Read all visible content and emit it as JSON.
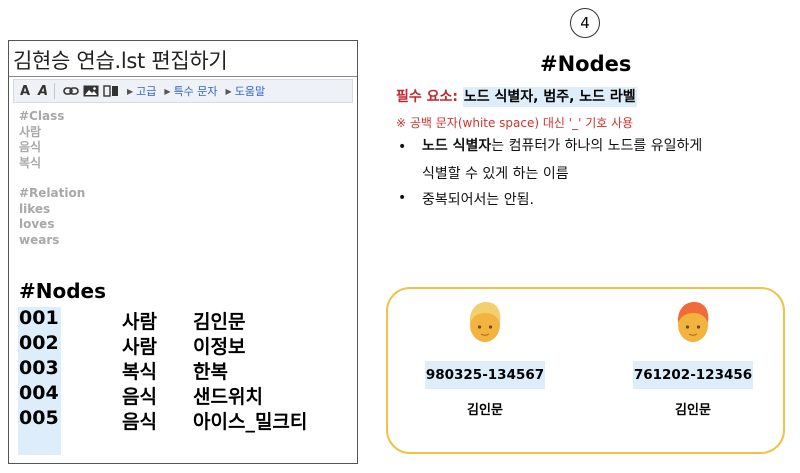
{
  "editor": {
    "title": "김현승 연습.lst 편집하기",
    "toolbar": {
      "bold_label": "A",
      "italic_label": "A",
      "menus": [
        "고급",
        "특수 문자",
        "도움말"
      ]
    },
    "class_section": [
      "#Class",
      "사람",
      "음식",
      "복식"
    ],
    "relation_section": [
      "#Relation",
      "likes",
      "loves",
      "wears"
    ],
    "nodes_heading": "#Nodes",
    "nodes": [
      {
        "id": "001",
        "category": "사람",
        "label": "김인문"
      },
      {
        "id": "002",
        "category": "사람",
        "label": "이정보"
      },
      {
        "id": "003",
        "category": "복식",
        "label": "한복"
      },
      {
        "id": "004",
        "category": "음식",
        "label": "샌드위치"
      },
      {
        "id": "005",
        "category": "음식",
        "label": "아이스_밀크티"
      }
    ]
  },
  "panel": {
    "step_number": "4",
    "title": "#Nodes",
    "required_label": "필수 요소:",
    "required_items": "노드 식별자, 범주, 노드 라벨",
    "note": "※ 공백 문자(white space) 대신 '_' 기호 사용",
    "bullet1_bold": "노드 식별자",
    "bullet1_rest": "는 컴퓨터가 하나의 노드를 유일하게",
    "bullet1_line2": "식별할 수 있게 하는 이름",
    "bullet2": "중복되어서는 안됨.",
    "people": [
      {
        "id": "980325-134567",
        "name": "김인문",
        "hair_color": "#f4cf6e"
      },
      {
        "id": "761202-123456",
        "name": "김인문",
        "hair_color": "#f06a3a"
      }
    ]
  },
  "colors": {
    "highlight": "#ddeefa",
    "accent_red": "#c0282d",
    "card_border": "#eec34a",
    "skin": "#f3b33f"
  }
}
